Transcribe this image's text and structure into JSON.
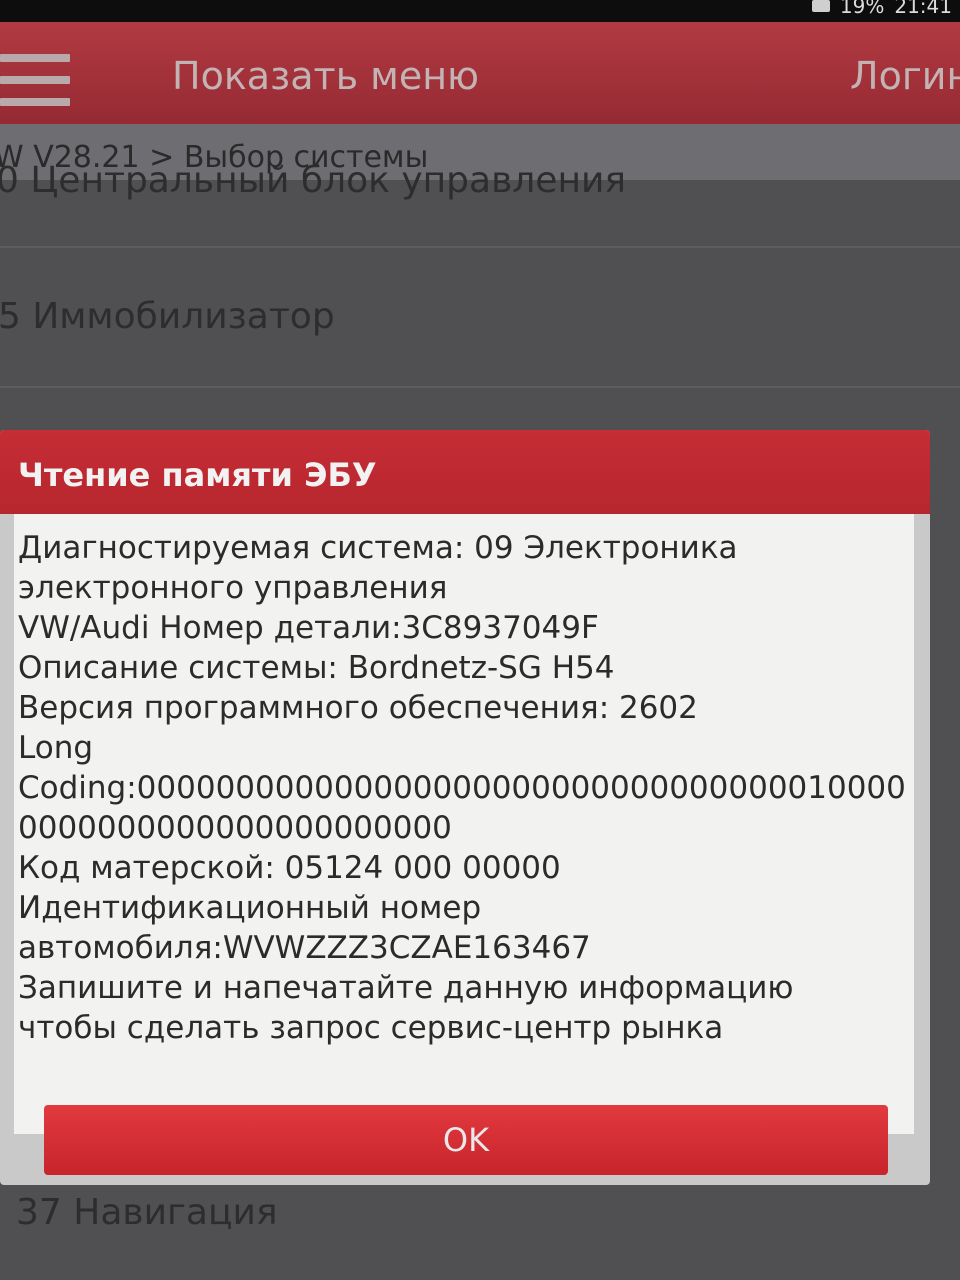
{
  "statusbar": {
    "battery": "19%",
    "time": "21:41"
  },
  "appbar": {
    "menu_label": "Показать меню",
    "login_label": "Логин"
  },
  "breadcrumb": {
    "text": "W V28.21 > Выбор системы"
  },
  "list": {
    "items": [
      "0 Центральный блок управления",
      "5 Иммобилизатор",
      "37 Навигация"
    ]
  },
  "dialog": {
    "title": "Чтение памяти ЭБУ",
    "lines": [
      "Диагностируемая система: 09 Электроника",
      "электронного управления",
      "VW/Audi Номер детали:3C8937049F",
      "Описание системы: Bordnetz-SG    H54",
      "Версия программного обеспечения: 2602",
      "Long",
      "Coding:000000000000000000000000000000000010000",
      "0000000000000000000000",
      "Код матерской: 05124  000  00000",
      "Идентификационный номер",
      "автомобиля:WVWZZZ3CZAE163467",
      "Запишите и напечатайте данную информацию",
      "чтобы сделать запрос сервис-центр рынка"
    ],
    "ok_label": "OK"
  }
}
